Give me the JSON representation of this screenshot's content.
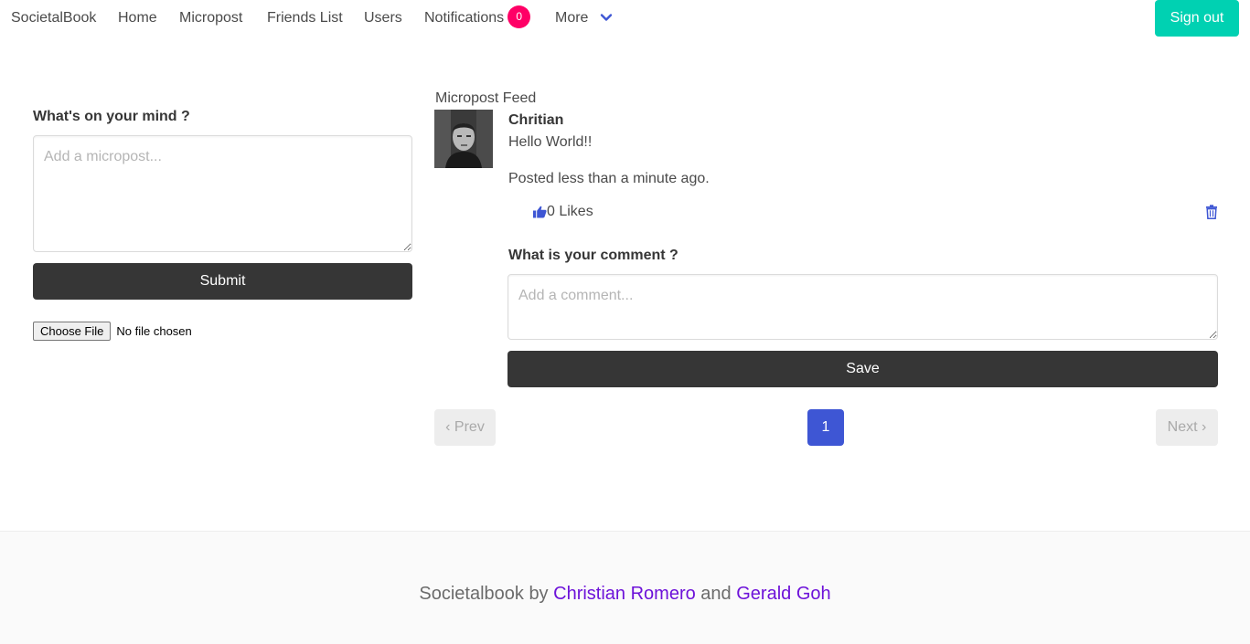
{
  "nav": {
    "brand": "SocietalBook",
    "home": "Home",
    "micropost": "Micropost",
    "friends_list": "Friends List",
    "users": "Users",
    "notifications": "Notifications",
    "notifications_count": "0",
    "more": "More",
    "sign_out": "Sign out"
  },
  "post_form": {
    "label": "What's on your mind ?",
    "placeholder": "Add a micropost...",
    "submit": "Submit",
    "choose_file": "Choose File",
    "file_status": "No file chosen"
  },
  "feed": {
    "title": "Micropost Feed",
    "posts": [
      {
        "author": "Chritian",
        "content": "Hello World!!",
        "posted": "Posted less than a minute ago.",
        "likes": "0 Likes",
        "comment_label": "What is your comment ?",
        "comment_placeholder": "Add a comment...",
        "save": "Save"
      }
    ]
  },
  "pagination": {
    "prev": "‹ Prev",
    "current": "1",
    "next": "Next ›"
  },
  "footer": {
    "prefix": "Societalbook by",
    "author1": "Christian Romero",
    "conjunction": "and",
    "author2": "Gerald Goh"
  },
  "colors": {
    "accent": "#3e56d4",
    "signout": "#00d1b2",
    "badge": "#ff0066",
    "dark_button": "#363636",
    "footer_link": "#6d12d9"
  },
  "icons": {
    "more": "chevron-down-icon",
    "like": "thumbs-up-icon",
    "delete": "trash-icon"
  }
}
